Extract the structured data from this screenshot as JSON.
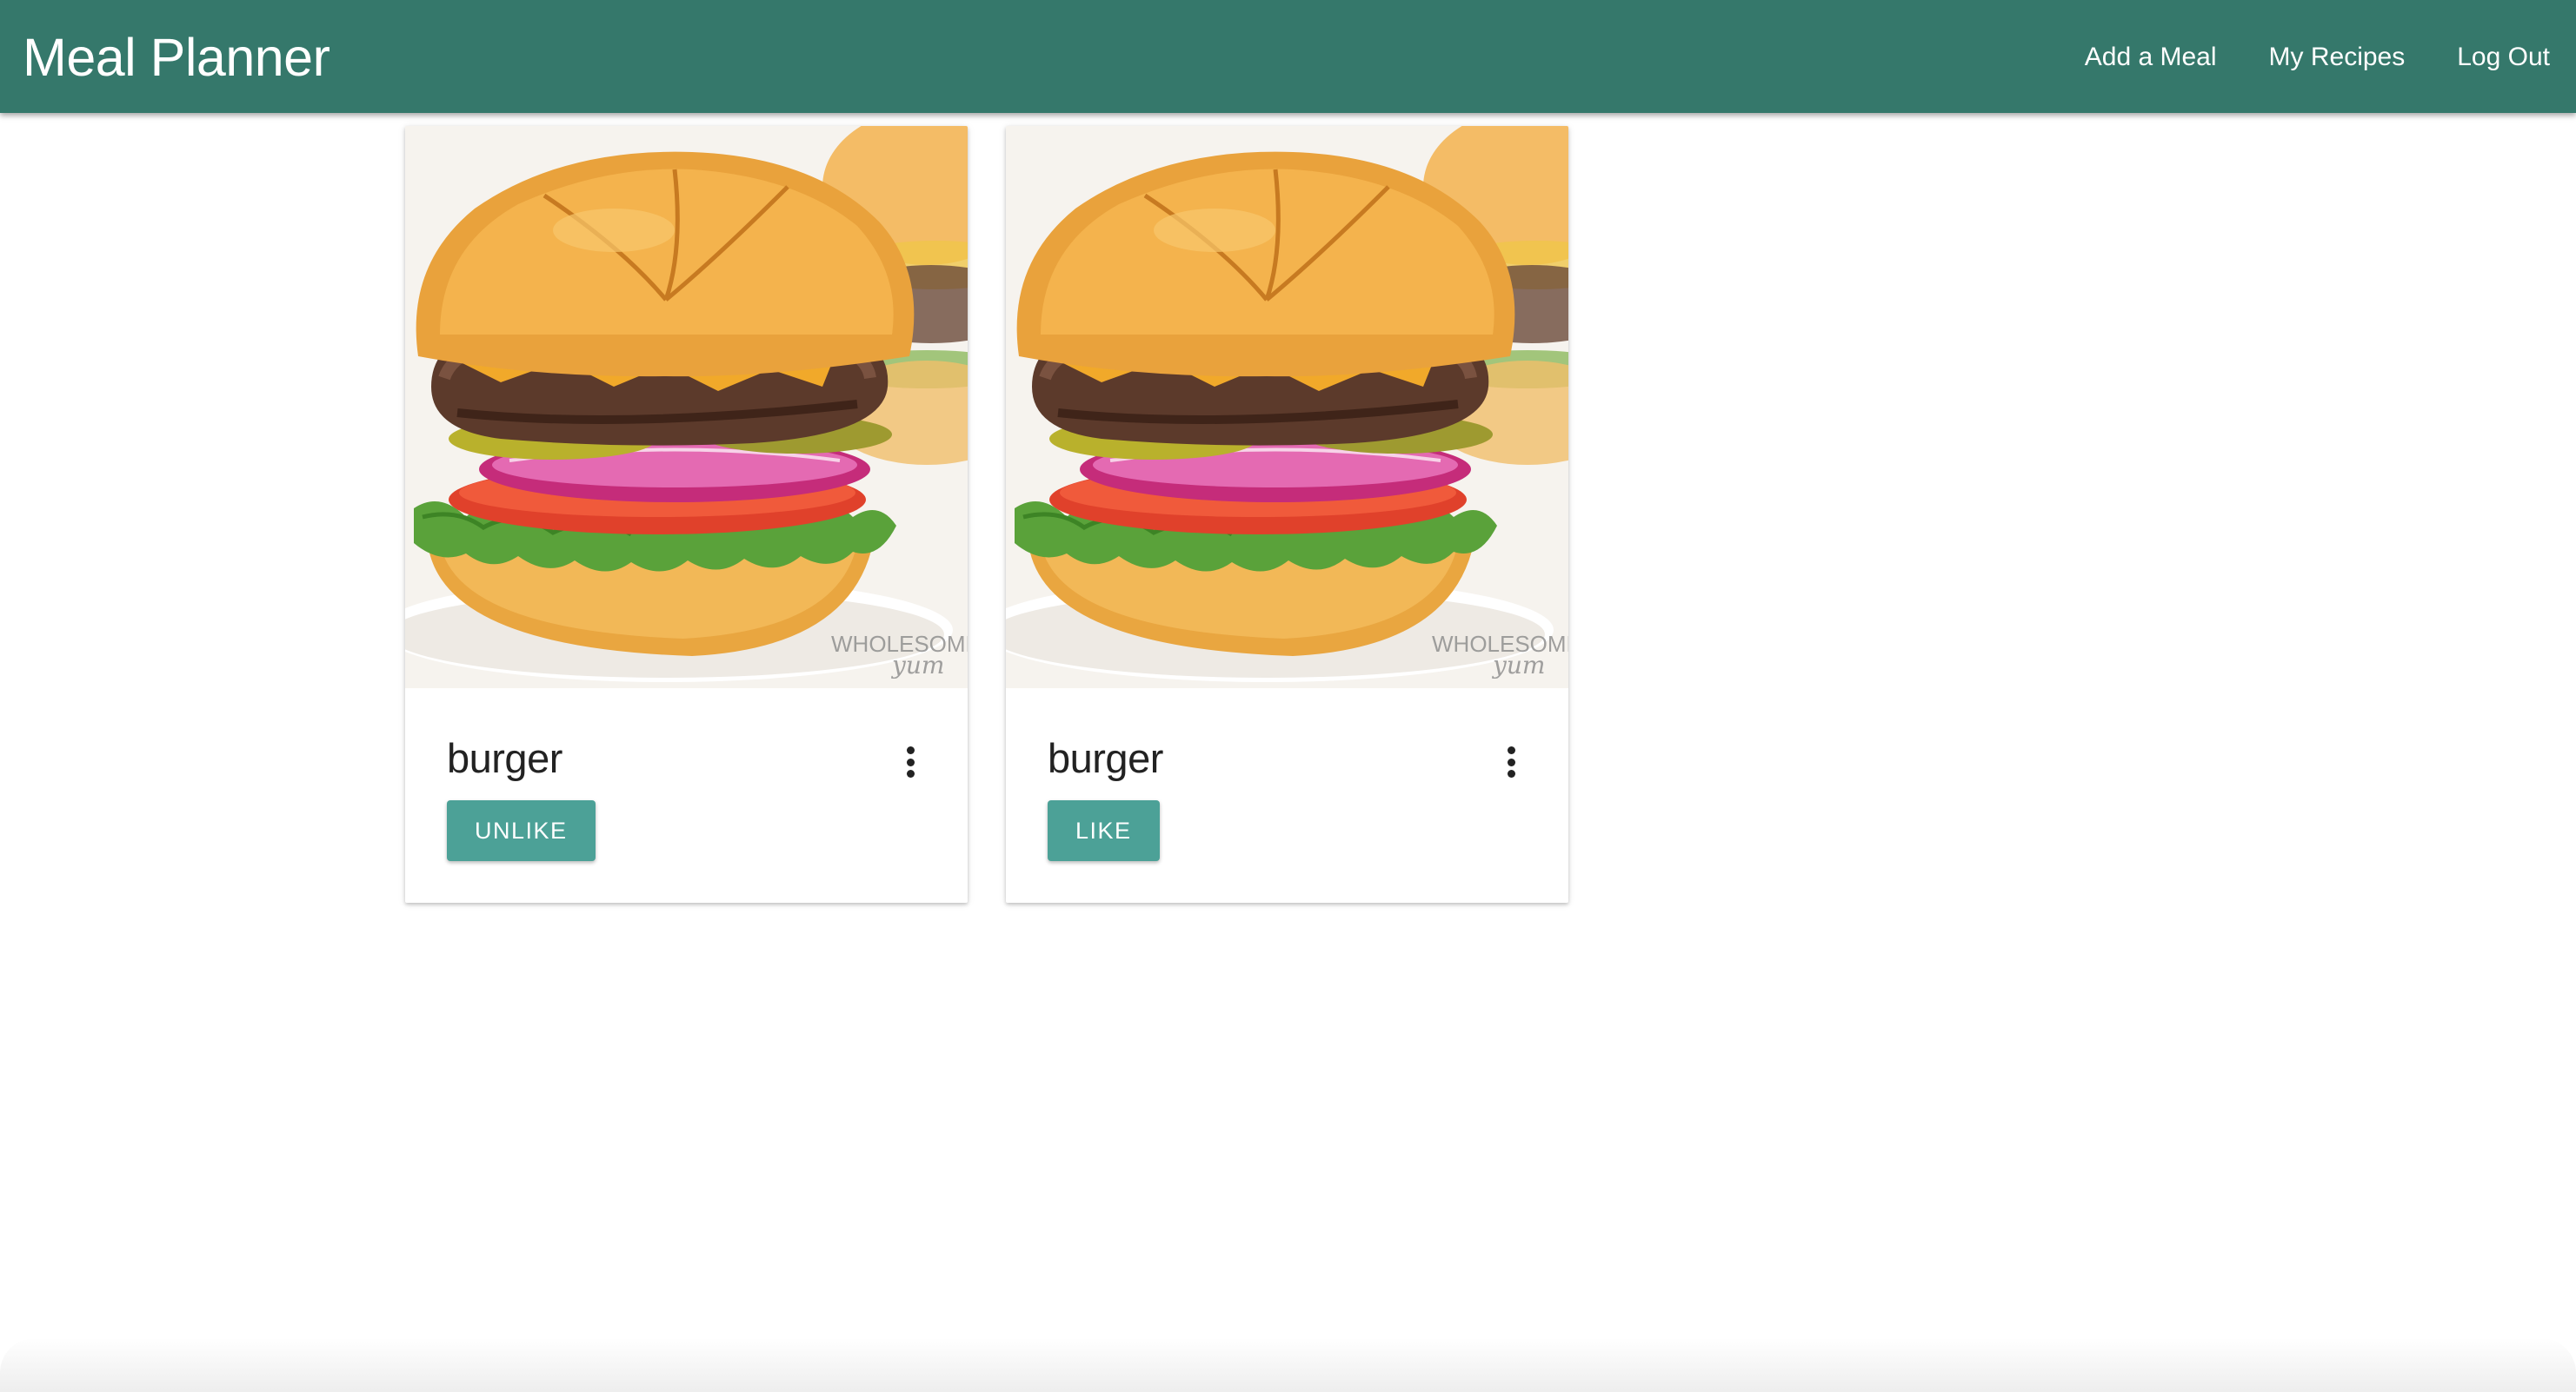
{
  "app": {
    "title": "Meal Planner"
  },
  "nav": {
    "links": [
      {
        "label": "Add a Meal"
      },
      {
        "label": "My Recipes"
      },
      {
        "label": "Log Out"
      }
    ]
  },
  "cards": [
    {
      "title": "burger",
      "button_label": "UNLIKE",
      "image": "burger-photo",
      "menu_icon": "more-vert-icon"
    },
    {
      "title": "burger",
      "button_label": "LIKE",
      "image": "burger-photo",
      "menu_icon": "more-vert-icon"
    }
  ],
  "colors": {
    "navbar": "#35786b",
    "button": "#4ca197"
  }
}
